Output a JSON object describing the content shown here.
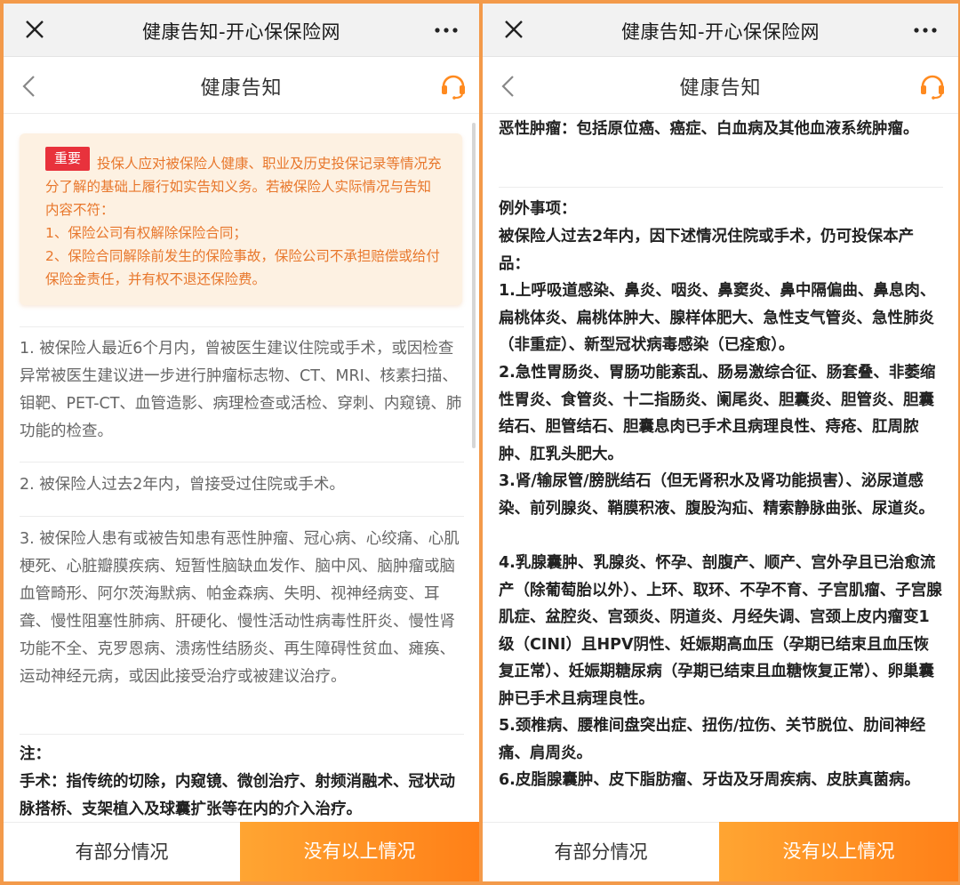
{
  "wechat": {
    "title": "健康告知-开心保保险网"
  },
  "header": {
    "title": "健康告知"
  },
  "left": {
    "notice": {
      "badge": "重要",
      "intro": "投保人应对被保险人健康、职业及历史投保记录等情况充分了解的基础上履行如实告知义务。若被保险人实际情况与告知内容不符：",
      "point1": "1、保险公司有权解除保险合同；",
      "point2": "2、保险合同解除前发生的保险事故，保险公司不承担赔偿或给付保险金责任，并有权不退还保险费。"
    },
    "items": [
      "1. 被保险人最近6个月内，曾被医生建议住院或手术，或因检查异常被医生建议进一步进行肿瘤标志物、CT、MRI、核素扫描、钼靶、PET-CT、血管造影、病理检查或活检、穿刺、内窥镜、肺功能的检查。",
      "2. 被保险人过去2年内，曾接受过住院或手术。",
      "3. 被保险人患有或被告知患有恶性肿瘤、冠心病、心绞痛、心肌梗死、心脏瓣膜疾病、短暂性脑缺血发作、脑中风、脑肿瘤或脑血管畸形、阿尔茨海默病、帕金森病、失明、视神经病变、耳聋、慢性阻塞性肺病、肝硬化、慢性活动性病毒性肝炎、慢性肾功能不全、克罗恩病、溃疡性结肠炎、再生障碍性贫血、瘫痪、运动神经元病，或因此接受治疗或被建议治疗。"
    ],
    "note_title": "注：",
    "note_text": "手术：指传统的切除，内窥镜、微创治疗、射频消融术、冠状动脉搭桥、支架植入及球囊扩张等在内的介入治疗。"
  },
  "right": {
    "tumor_def": "恶性肿瘤：包括原位癌、癌症、白血病及其他血液系统肿瘤。",
    "exceptions_title": "例外事项：",
    "exceptions_intro": "被保险人过去2年内，因下述情况住院或手术，仍可投保本产品：",
    "exceptions": [
      "1.上呼吸道感染、鼻炎、咽炎、鼻窦炎、鼻中隔偏曲、鼻息肉、扁桃体炎、扁桃体肿大、腺样体肥大、急性支气管炎、急性肺炎（非重症）、新型冠状病毒感染（已痊愈）。",
      "2.急性胃肠炎、胃肠功能紊乱、肠易激综合征、肠套叠、非萎缩性胃炎、食管炎、十二指肠炎、阑尾炎、胆囊炎、胆管炎、胆囊结石、胆管结石、胆囊息肉已手术且病理良性、痔疮、肛周脓肿、肛乳头肥大。",
      "3.肾/输尿管/膀胱结石（但无肾积水及肾功能损害）、泌尿道感染、前列腺炎、鞘膜积液、腹股沟疝、精索静脉曲张、尿道炎。",
      "4.乳腺囊肿、乳腺炎、怀孕、剖腹产、顺产、宫外孕且已治愈流产（除葡萄胎以外）、上环、取环、不孕不育、子宫肌瘤、子宫腺肌症、盆腔炎、宫颈炎、阴道炎、月经失调、宫颈上皮内瘤变1级（CINI）且HPV阴性、妊娠期高血压（孕期已结束且血压恢复正常）、妊娠期糖尿病（孕期已结束且血糖恢复正常）、卵巢囊肿已手术且病理良性。",
      "5.颈椎病、腰椎间盘突出症、扭伤/拉伤、关节脱位、肋间神经痛、肩周炎。",
      "6.皮脂腺囊肿、皮下脂肪瘤、牙齿及牙周疾病、皮肤真菌病。"
    ]
  },
  "buttons": {
    "partial": "有部分情况",
    "none": "没有以上情况"
  },
  "colors": {
    "accent": "#ff8a1f",
    "badge": "#e8323c",
    "notice_text": "#e8772c",
    "frame": "#f39a4a"
  },
  "icons": {
    "close": "close-icon",
    "more": "more-icon",
    "back": "back-icon",
    "service": "headset-icon"
  }
}
